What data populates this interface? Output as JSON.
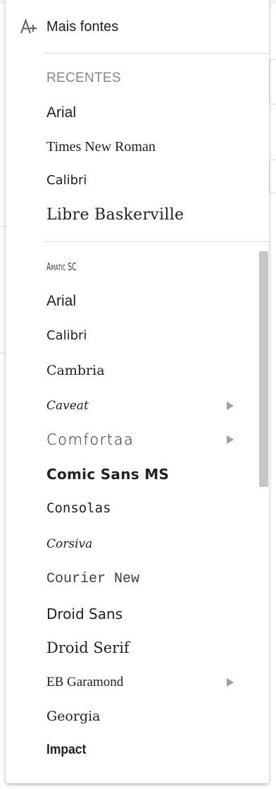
{
  "more_fonts": {
    "label": "Mais fontes",
    "icon": "add-font-icon"
  },
  "recent": {
    "header": "RECENTES",
    "items": [
      {
        "label": "Arial"
      },
      {
        "label": "Times New Roman"
      },
      {
        "label": "Calibri"
      },
      {
        "label": "Libre Baskerville"
      }
    ]
  },
  "all_fonts": {
    "items": [
      {
        "label": "Amatic SC",
        "submenu": false
      },
      {
        "label": "Arial",
        "submenu": false
      },
      {
        "label": "Calibri",
        "submenu": false
      },
      {
        "label": "Cambria",
        "submenu": false
      },
      {
        "label": "Caveat",
        "submenu": true
      },
      {
        "label": "Comfortaa",
        "submenu": true
      },
      {
        "label": "Comic Sans MS",
        "submenu": false
      },
      {
        "label": "Consolas",
        "submenu": false
      },
      {
        "label": "Corsiva",
        "submenu": false
      },
      {
        "label": "Courier New",
        "submenu": false
      },
      {
        "label": "Droid Sans",
        "submenu": false
      },
      {
        "label": "Droid Serif",
        "submenu": false
      },
      {
        "label": "EB Garamond",
        "submenu": true
      },
      {
        "label": "Georgia",
        "submenu": false
      },
      {
        "label": "Impact",
        "submenu": false
      }
    ]
  },
  "colors": {
    "text": "#202124",
    "header": "#80868b",
    "divider": "#dadce0",
    "scrollbar": "#c6c6c6",
    "arrow": "#9aa0a6"
  }
}
